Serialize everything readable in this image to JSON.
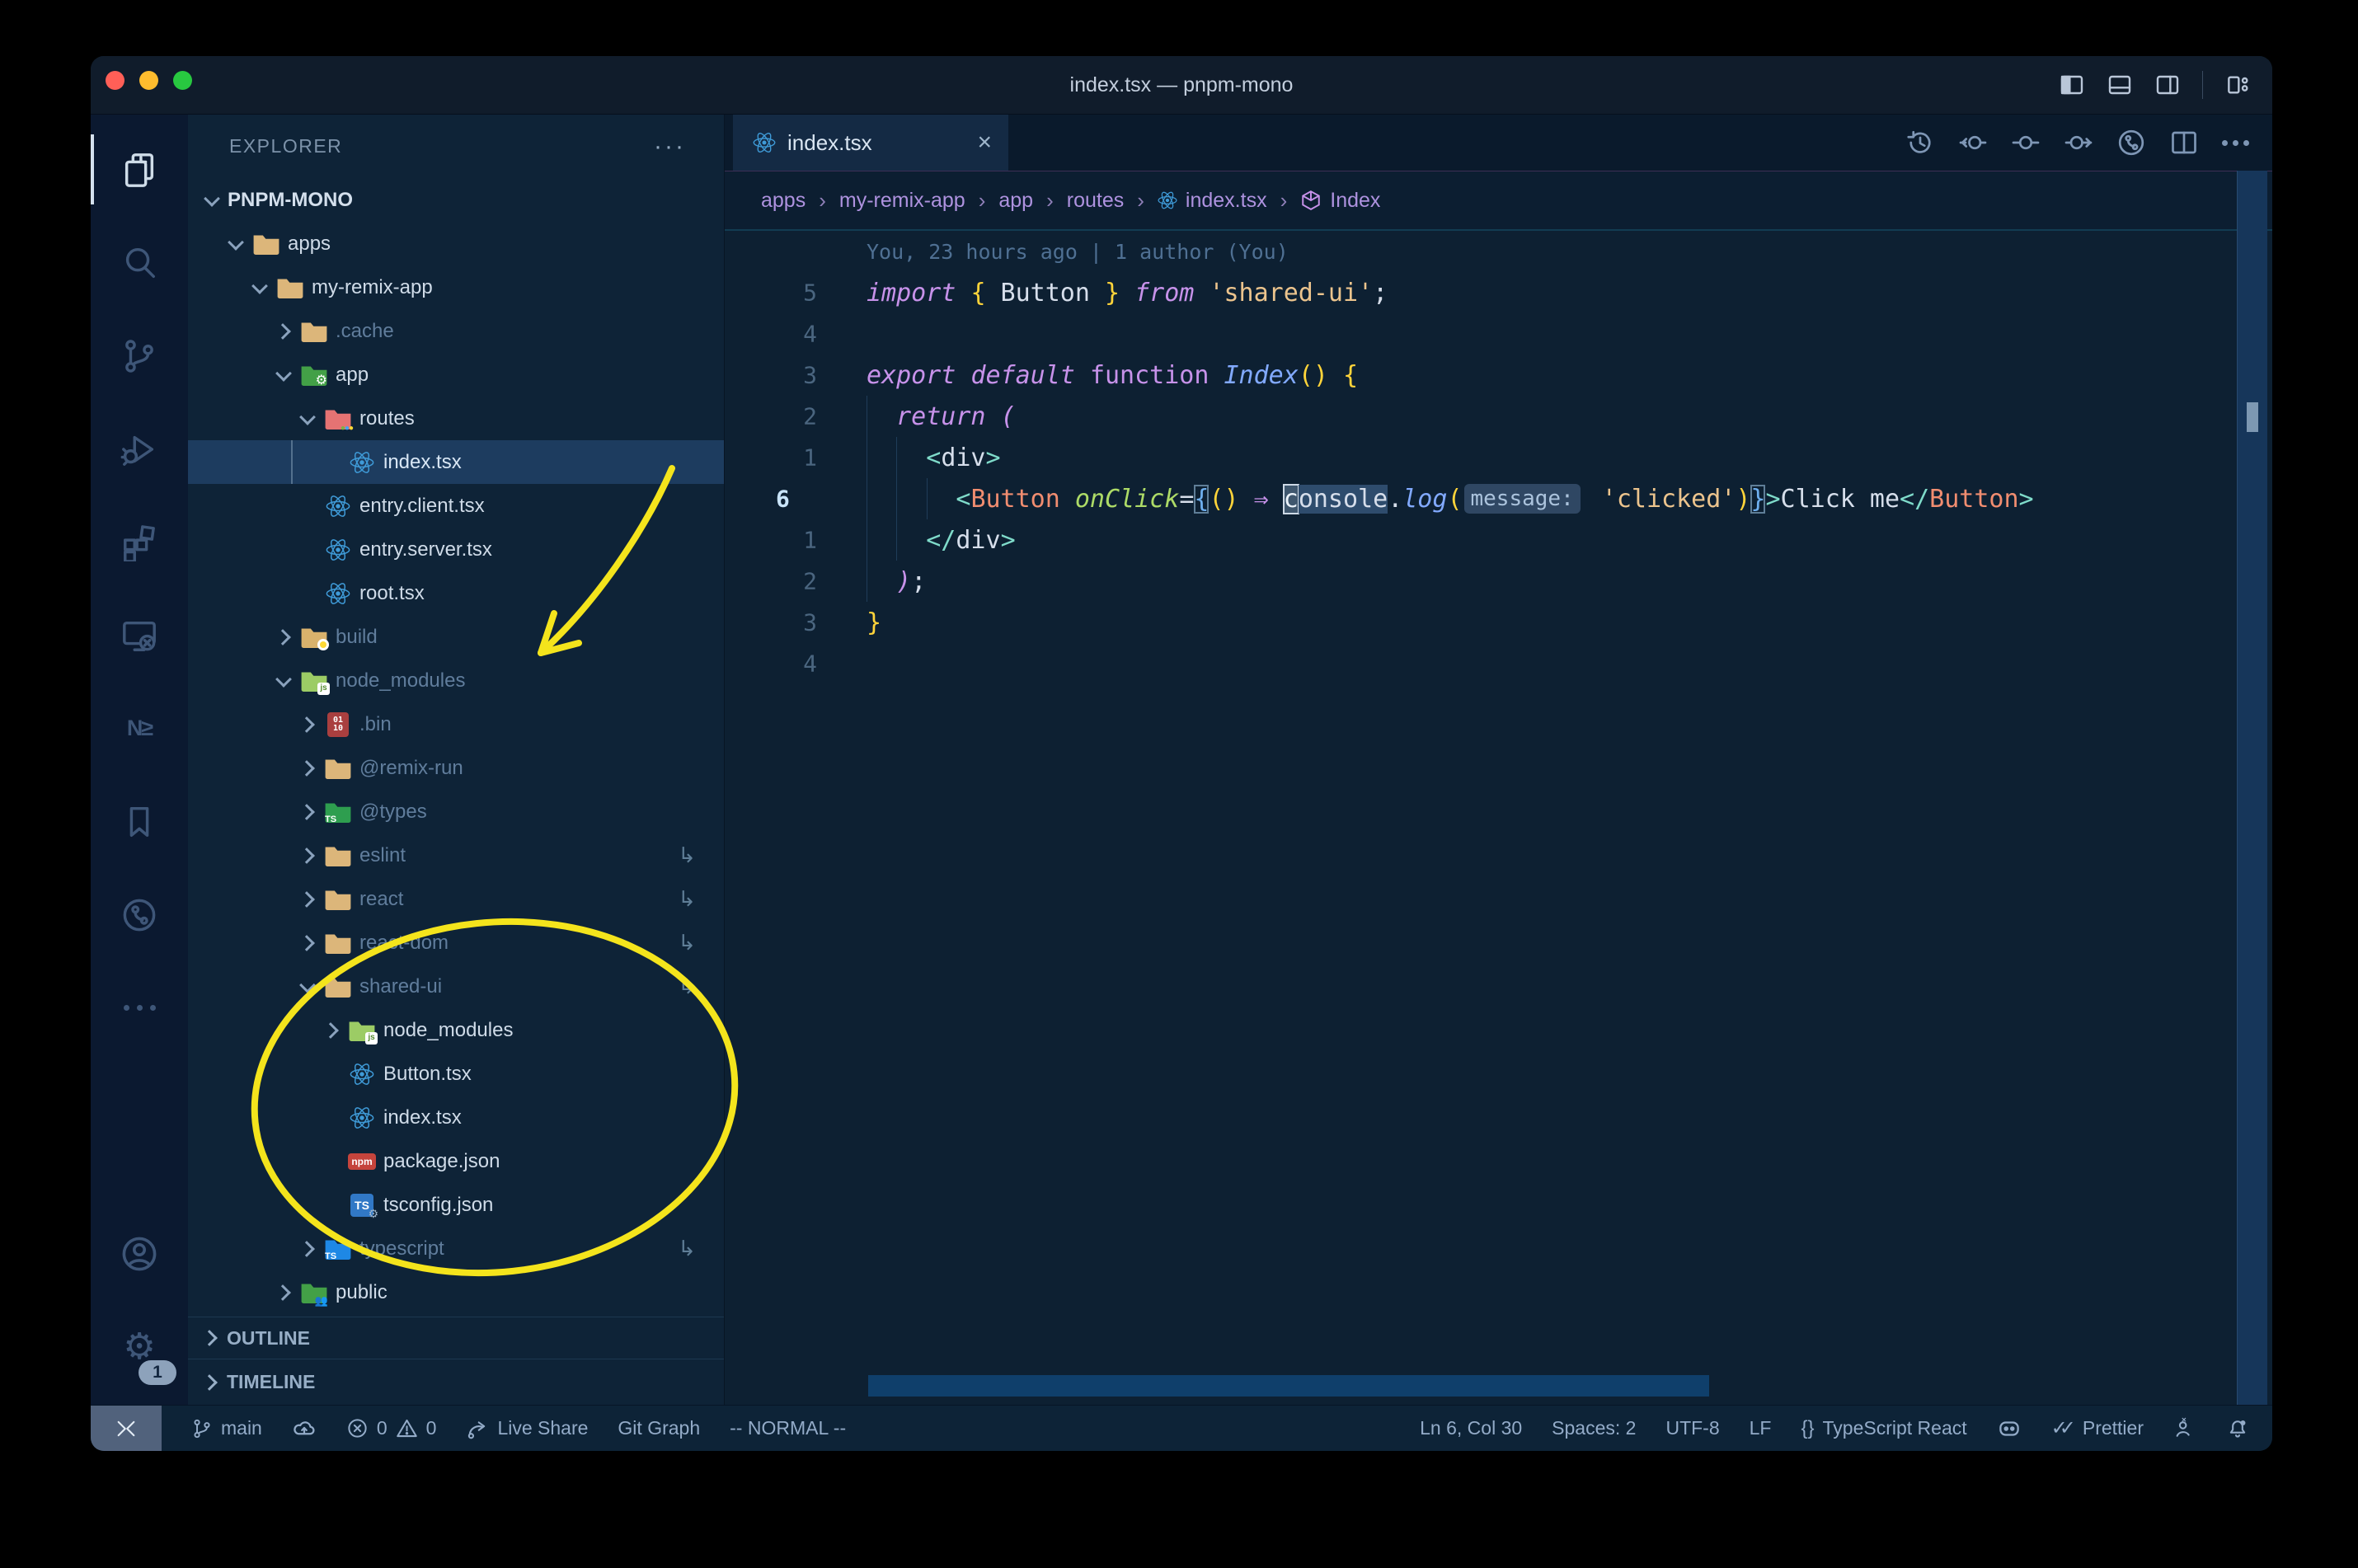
{
  "window": {
    "title": "index.tsx — pnpm-mono"
  },
  "titlebar": {
    "traffic_lights": [
      "close",
      "minimize",
      "zoom"
    ],
    "layout_icons": [
      "toggle-primary-sidebar-icon",
      "toggle-panel-icon",
      "toggle-secondary-sidebar-icon",
      "customize-layout-icon"
    ]
  },
  "activity_bar": {
    "top": [
      {
        "name": "explorer-icon",
        "active": true
      },
      {
        "name": "search-icon",
        "active": false
      },
      {
        "name": "source-control-icon",
        "active": false
      },
      {
        "name": "run-debug-icon",
        "active": false
      },
      {
        "name": "extensions-icon",
        "active": false
      },
      {
        "name": "remote-explorer-icon",
        "active": false
      },
      {
        "name": "nx-console-icon",
        "active": false
      },
      {
        "name": "bookmarks-icon",
        "active": false
      },
      {
        "name": "gitlens-icon",
        "active": false
      },
      {
        "name": "more-views-icon",
        "active": false
      }
    ],
    "bottom": [
      {
        "name": "account-icon"
      },
      {
        "name": "settings-gear-icon",
        "badge": "1"
      }
    ]
  },
  "explorer": {
    "header": "EXPLORER",
    "more": "···"
  },
  "tree": [
    {
      "label": "PNPM-MONO",
      "icon": null,
      "level": 0,
      "expand": "down",
      "header": true
    },
    {
      "label": "apps",
      "icon": "folder-tan",
      "level": 1,
      "expand": "down"
    },
    {
      "label": "my-remix-app",
      "icon": "folder-tan",
      "level": 2,
      "expand": "down"
    },
    {
      "label": ".cache",
      "icon": "folder-tan",
      "level": 3,
      "expand": "right",
      "dim": true
    },
    {
      "label": "app",
      "icon": "folder-app",
      "level": 3,
      "expand": "down"
    },
    {
      "label": "routes",
      "icon": "folder-routes",
      "level": 4,
      "expand": "down"
    },
    {
      "label": "index.tsx",
      "icon": "react",
      "level": 5,
      "selected": true
    },
    {
      "label": "entry.client.tsx",
      "icon": "react",
      "level": 4
    },
    {
      "label": "entry.server.tsx",
      "icon": "react",
      "level": 4
    },
    {
      "label": "root.tsx",
      "icon": "react",
      "level": 4
    },
    {
      "label": "build",
      "icon": "folder-build",
      "level": 3,
      "expand": "right",
      "dim": true
    },
    {
      "label": "node_modules",
      "icon": "folder-node",
      "level": 3,
      "expand": "down",
      "dim": true
    },
    {
      "label": ".bin",
      "icon": "file-binary",
      "level": 4,
      "expand": "right",
      "dim": true
    },
    {
      "label": "@remix-run",
      "icon": "folder-tan",
      "level": 4,
      "expand": "right",
      "dim": true
    },
    {
      "label": "@types",
      "icon": "folder-types",
      "level": 4,
      "expand": "right",
      "dim": true
    },
    {
      "label": "eslint",
      "icon": "folder-tan",
      "level": 4,
      "expand": "right",
      "dim": true,
      "symlink": true
    },
    {
      "label": "react",
      "icon": "folder-tan",
      "level": 4,
      "expand": "right",
      "dim": true,
      "symlink": true
    },
    {
      "label": "react-dom",
      "icon": "folder-tan",
      "level": 4,
      "expand": "right",
      "dim": true,
      "symlink": true
    },
    {
      "label": "shared-ui",
      "icon": "folder-tan",
      "level": 4,
      "expand": "down",
      "dim": true,
      "symlink": true
    },
    {
      "label": "node_modules",
      "icon": "folder-node",
      "level": 5,
      "expand": "right"
    },
    {
      "label": "Button.tsx",
      "icon": "react",
      "level": 5
    },
    {
      "label": "index.tsx",
      "icon": "react",
      "level": 5
    },
    {
      "label": "package.json",
      "icon": "npm",
      "level": 5
    },
    {
      "label": "tsconfig.json",
      "icon": "tsconfig",
      "level": 5
    },
    {
      "label": "typescript",
      "icon": "folder-ts",
      "level": 4,
      "expand": "right",
      "dim": true,
      "symlink": true
    },
    {
      "label": "public",
      "icon": "folder-public",
      "level": 3,
      "expand": "right"
    }
  ],
  "panels": {
    "outline": "OUTLINE",
    "timeline": "TIMELINE"
  },
  "tab": {
    "label": "index.tsx",
    "icon": "react-icon",
    "close": "×"
  },
  "editor_actions": [
    "history-icon",
    "previous-change-icon",
    "change-icon",
    "next-change-icon",
    "gitlens-circle-icon",
    "split-editor-icon",
    "more-actions-icon"
  ],
  "breadcrumbs": {
    "separator": "›",
    "items": [
      {
        "label": "apps"
      },
      {
        "label": "my-remix-app"
      },
      {
        "label": "app"
      },
      {
        "label": "routes"
      },
      {
        "label": "index.tsx",
        "icon": "react"
      },
      {
        "label": "Index",
        "icon": "symbol-cube"
      }
    ]
  },
  "editor": {
    "blame": "You, 23 hours ago | 1 author (You)",
    "lines": [
      {
        "type": "blame"
      },
      {
        "num": "5",
        "tokens": [
          [
            "ki",
            "import"
          ],
          [
            "v",
            " "
          ],
          [
            "b",
            "{"
          ],
          [
            "v",
            " Button "
          ],
          [
            "b",
            "}"
          ],
          [
            "v",
            " "
          ],
          [
            "ki",
            "from"
          ],
          [
            "v",
            " "
          ],
          [
            "s",
            "'shared-ui'"
          ],
          [
            "v",
            ";"
          ]
        ]
      },
      {
        "num": "4",
        "tokens": []
      },
      {
        "num": "3",
        "tokens": [
          [
            "ki",
            "export"
          ],
          [
            "v",
            " "
          ],
          [
            "ki",
            "default"
          ],
          [
            "v",
            " "
          ],
          [
            "k",
            "function"
          ],
          [
            "v",
            " "
          ],
          [
            "f",
            "Index"
          ],
          [
            "b",
            "()"
          ],
          [
            "v",
            " "
          ],
          [
            "b",
            "{"
          ]
        ]
      },
      {
        "num": "2",
        "tokens": [
          [
            "v",
            "  "
          ],
          [
            "ki",
            "return"
          ],
          [
            "v",
            " "
          ],
          [
            "o",
            "("
          ]
        ]
      },
      {
        "num": "1",
        "tokens": [
          [
            "v",
            "    "
          ],
          [
            "t",
            "<"
          ],
          [
            "v",
            "div"
          ],
          [
            "t",
            ">"
          ]
        ]
      },
      {
        "num": "6",
        "current": true,
        "tokens": [
          [
            "v",
            "      "
          ],
          [
            "t",
            "<"
          ],
          [
            "c",
            "Button"
          ],
          [
            "v",
            " "
          ],
          [
            "a",
            "onClick"
          ],
          [
            "v",
            "="
          ],
          [
            "bm",
            "{"
          ],
          [
            "b",
            "()"
          ],
          [
            "v",
            " "
          ],
          [
            "o",
            "⇒"
          ],
          [
            "v",
            " "
          ],
          [
            "cur",
            "c"
          ],
          [
            "wh",
            "onsole"
          ],
          [
            "v",
            "."
          ],
          [
            "f",
            "log"
          ],
          [
            "b",
            "("
          ],
          [
            "in",
            "message:"
          ],
          [
            "v",
            " "
          ],
          [
            "s",
            "'clicked'"
          ],
          [
            "b",
            ")"
          ],
          [
            "bm",
            "}"
          ],
          [
            "t",
            ">"
          ],
          [
            "v",
            "Click me"
          ],
          [
            "t",
            "</"
          ],
          [
            "c",
            "Button"
          ],
          [
            "t",
            ">"
          ]
        ]
      },
      {
        "num": "1",
        "tokens": [
          [
            "v",
            "    "
          ],
          [
            "t",
            "</"
          ],
          [
            "v",
            "div"
          ],
          [
            "t",
            ">"
          ]
        ]
      },
      {
        "num": "2",
        "tokens": [
          [
            "v",
            "  "
          ],
          [
            "o",
            ")"
          ],
          [
            "v",
            ";"
          ]
        ]
      },
      {
        "num": "3",
        "tokens": [
          [
            "b",
            "}"
          ]
        ]
      },
      {
        "num": "4",
        "tokens": []
      }
    ]
  },
  "status_bar": {
    "left": [
      {
        "name": "remote-indicator",
        "icon": "remote-icon",
        "block": true
      },
      {
        "name": "git-branch",
        "icon": "branch-icon",
        "label": "main"
      },
      {
        "name": "sync-cloud",
        "icon": "cloud-upload-icon"
      },
      {
        "name": "problems",
        "icon": "error-icon",
        "label": "0",
        "icon2": "warning-icon",
        "label2": "0"
      },
      {
        "name": "live-share",
        "icon": "live-share-icon",
        "label": "Live Share"
      },
      {
        "name": "git-graph",
        "label": "Git Graph"
      },
      {
        "name": "vim-mode",
        "label": "-- NORMAL --"
      }
    ],
    "right": [
      {
        "name": "cursor-position",
        "label": "Ln 6, Col 30"
      },
      {
        "name": "indentation",
        "label": "Spaces: 2"
      },
      {
        "name": "encoding",
        "label": "UTF-8"
      },
      {
        "name": "eol",
        "label": "LF"
      },
      {
        "name": "language-mode",
        "icon": "braces-icon",
        "label": "TypeScript React"
      },
      {
        "name": "copilot",
        "icon": "copilot-icon"
      },
      {
        "name": "prettier",
        "icon": "double-check-icon",
        "label": "Prettier"
      },
      {
        "name": "feedback",
        "icon": "feedback-icon"
      },
      {
        "name": "notifications",
        "icon": "bell-icon"
      }
    ]
  },
  "annotations": {
    "color": "#f4e41c"
  },
  "colors": {
    "traffic_red": "#ff5f57",
    "traffic_yellow": "#febc2e",
    "traffic_green": "#28c840",
    "editor_bg": "#0d2032",
    "sidebar_bg": "#0e2337",
    "selection_bg": "#1d3c5f",
    "keyword": "#c792ea",
    "string": "#ecc48d",
    "function": "#82aaff",
    "component": "#f18d70",
    "attribute": "#addb67",
    "brace": "#ffd43a",
    "jsx_punct": "#7fdbca"
  }
}
